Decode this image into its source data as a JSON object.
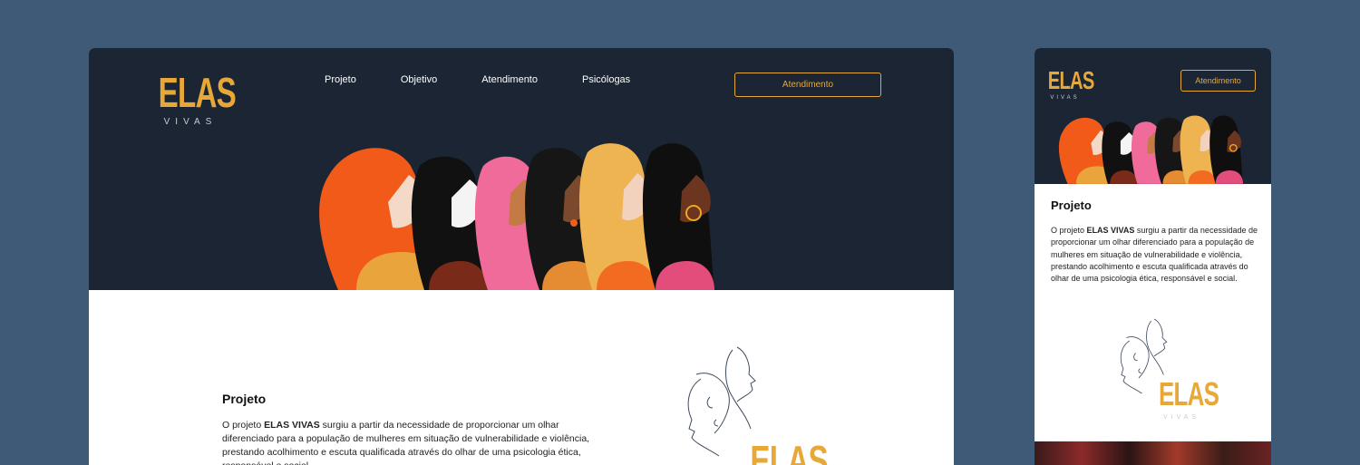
{
  "brand": {
    "name": "ELAS",
    "tagline": "VIVAS"
  },
  "nav": {
    "items": [
      "Projeto",
      "Objetivo",
      "Atendimento",
      "Psicólogas"
    ]
  },
  "cta": {
    "label": "Atendimento"
  },
  "content": {
    "title": "Projeto",
    "text_lead": "O projeto ",
    "text_strong": "ELAS VIVAS",
    "text_rest": " surgiu a partir da necessidade de proporcionar um olhar diferenciado para a população de mulheres em situação de vulnerabilidade e violência, prestando acolhimento e escuta qualificada através do olhar de uma psicologia ética, responsável e social."
  },
  "colors": {
    "page_background": "#3e5a77",
    "hero_background": "#1b2533",
    "accent": "#e8a837",
    "content_background": "#ffffff"
  },
  "icons": [
    "women-profiles-illustration",
    "line-art-faces-icon"
  ]
}
